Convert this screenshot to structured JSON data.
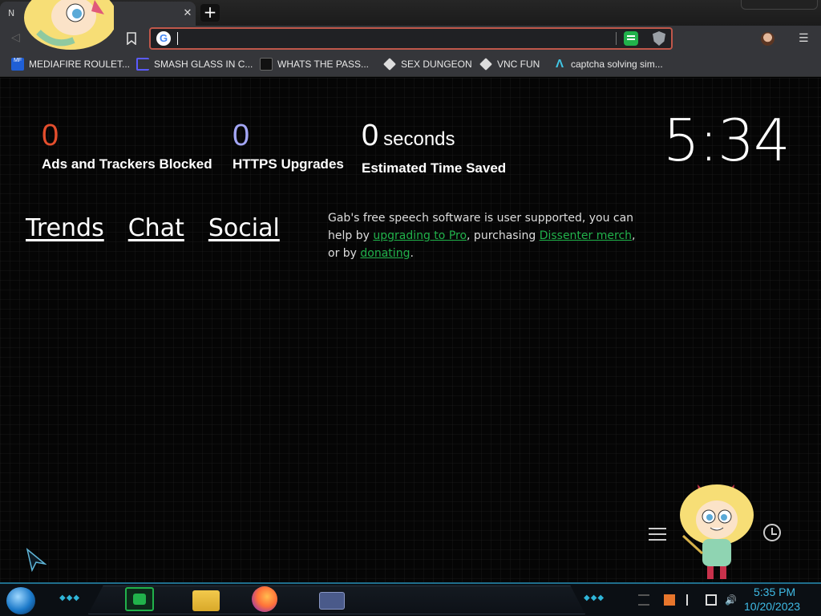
{
  "browser": {
    "tab": {
      "title": "N"
    },
    "omnibox": {
      "value": "",
      "placeholder": ""
    }
  },
  "bookmarks": [
    {
      "label": "MEDIAFIRE ROULET...",
      "icon": "mediafire-icon"
    },
    {
      "label": "SMASH GLASS IN C...",
      "icon": "bracket-icon"
    },
    {
      "label": "WHATS THE PASS...",
      "icon": "lock-icon"
    },
    {
      "label": "SEX DUNGEON",
      "icon": "cube-icon"
    },
    {
      "label": "VNC FUN",
      "icon": "cube-icon"
    },
    {
      "label": "captcha solving sim...",
      "icon": "a-icon"
    }
  ],
  "stats": {
    "ads": {
      "value": "0",
      "label": "Ads and Trackers Blocked",
      "color": "#e44e2d"
    },
    "https": {
      "value": "0",
      "label": "HTTPS Upgrades",
      "color": "#a3a6f5"
    },
    "time": {
      "value": "0",
      "unit": "seconds",
      "label": "Estimated Time Saved"
    }
  },
  "clock": "5:34",
  "links": {
    "trends": "Trends",
    "chat": "Chat",
    "social": "Social"
  },
  "gab_note": {
    "prefix": "Gab's free speech software is user supported, you can help by ",
    "link1": "upgrading to Pro",
    "mid1": ", purchasing ",
    "link2": "Dissenter merch",
    "mid2": ", or by ",
    "link3": "donating",
    "suffix": "."
  },
  "taskbar": {
    "time": "5:35 PM",
    "date": "10/20/2023"
  },
  "colors": {
    "accent": "#21b24b",
    "omnibox_border": "#c0574a",
    "tray_text": "#3fbbe6"
  }
}
